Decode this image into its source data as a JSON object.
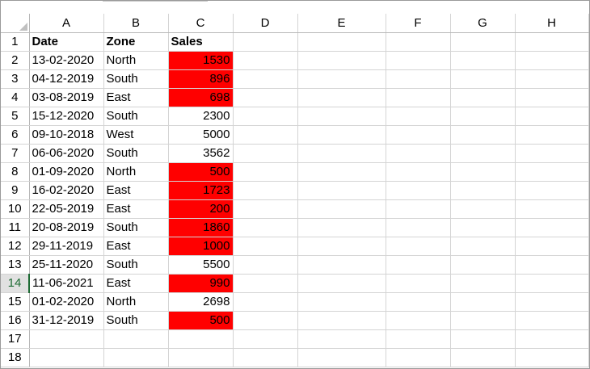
{
  "columns": [
    "A",
    "B",
    "C",
    "D",
    "E",
    "F",
    "G",
    "H"
  ],
  "active_row": "14",
  "highlight_color": "#ff0000",
  "header_row": {
    "num": "1",
    "date": "Date",
    "zone": "Zone",
    "sales": "Sales"
  },
  "rows": [
    {
      "num": "2",
      "date": "13-02-2020",
      "zone": "North",
      "sales": "1530",
      "highlight": true
    },
    {
      "num": "3",
      "date": "04-12-2019",
      "zone": "South",
      "sales": "896",
      "highlight": true
    },
    {
      "num": "4",
      "date": "03-08-2019",
      "zone": "East",
      "sales": "698",
      "highlight": true
    },
    {
      "num": "5",
      "date": "15-12-2020",
      "zone": "South",
      "sales": "2300",
      "highlight": false
    },
    {
      "num": "6",
      "date": "09-10-2018",
      "zone": "West",
      "sales": "5000",
      "highlight": false
    },
    {
      "num": "7",
      "date": "06-06-2020",
      "zone": "South",
      "sales": "3562",
      "highlight": false
    },
    {
      "num": "8",
      "date": "01-09-2020",
      "zone": "North",
      "sales": "500",
      "highlight": true
    },
    {
      "num": "9",
      "date": "16-02-2020",
      "zone": "East",
      "sales": "1723",
      "highlight": true
    },
    {
      "num": "10",
      "date": "22-05-2019",
      "zone": "East",
      "sales": "200",
      "highlight": true
    },
    {
      "num": "11",
      "date": "20-08-2019",
      "zone": "South",
      "sales": "1860",
      "highlight": true
    },
    {
      "num": "12",
      "date": "29-11-2019",
      "zone": "East",
      "sales": "1000",
      "highlight": true
    },
    {
      "num": "13",
      "date": "25-11-2020",
      "zone": "South",
      "sales": "5500",
      "highlight": false
    },
    {
      "num": "14",
      "date": "11-06-2021",
      "zone": "East",
      "sales": "990",
      "highlight": true
    },
    {
      "num": "15",
      "date": "01-02-2020",
      "zone": "North",
      "sales": "2698",
      "highlight": false
    },
    {
      "num": "16",
      "date": "31-12-2019",
      "zone": "South",
      "sales": "500",
      "highlight": true
    }
  ],
  "empty_rows": [
    "17",
    "18"
  ]
}
